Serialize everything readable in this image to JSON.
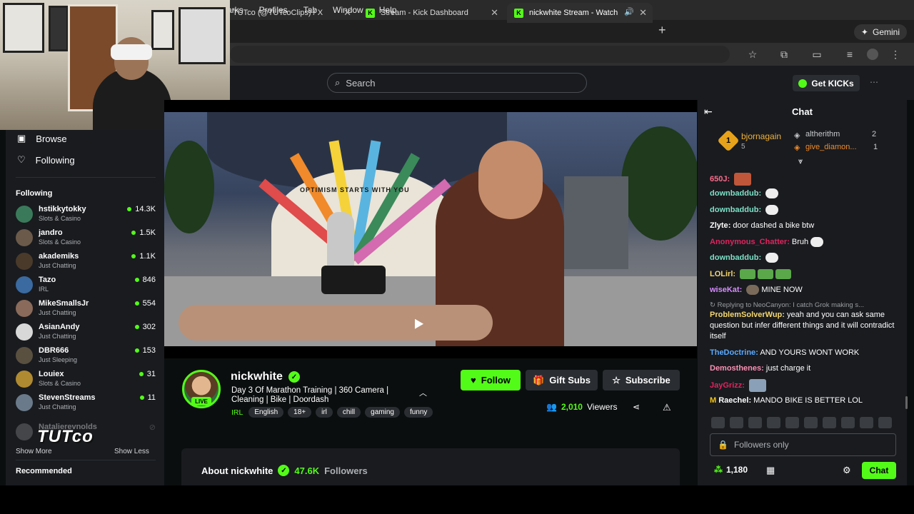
{
  "menubar": {
    "items": [
      "arks",
      "Profiles",
      "Tab",
      "Window",
      "Help"
    ]
  },
  "tabs": [
    {
      "label": "TUTco (@TUTcoClips) / X"
    },
    {
      "label": "Stream - Kick Dashboard"
    },
    {
      "label": "nickwhite Stream - Watch"
    }
  ],
  "gemini_label": "Gemini",
  "search": {
    "placeholder": "Search"
  },
  "get_kicks_label": "Get KICKs",
  "sidebar": {
    "nav": [
      {
        "label": "Browse"
      },
      {
        "label": "Following"
      }
    ],
    "following_heading": "Following",
    "following": [
      {
        "name": "hstikkytokky",
        "category": "Slots & Casino",
        "viewers": "14.3K"
      },
      {
        "name": "jandro",
        "category": "Slots & Casino",
        "viewers": "1.5K"
      },
      {
        "name": "akademiks",
        "category": "Just Chatting",
        "viewers": "1.1K"
      },
      {
        "name": "Tazo",
        "category": "IRL",
        "viewers": "846"
      },
      {
        "name": "MikeSmallsJr",
        "category": "Just Chatting",
        "viewers": "554"
      },
      {
        "name": "AsianAndy",
        "category": "Just Chatting",
        "viewers": "302"
      },
      {
        "name": "DBR666",
        "category": "Just Sleeping",
        "viewers": "153"
      },
      {
        "name": "Louiex",
        "category": "Slots & Casino",
        "viewers": "31"
      },
      {
        "name": "StevenStreams",
        "category": "Just Chatting",
        "viewers": "11"
      },
      {
        "name": "Natalierevnolds",
        "category": "",
        "viewers": ""
      }
    ],
    "show_more": "Show More",
    "show_less": "Show Less",
    "recommended_heading": "Recommended"
  },
  "watermark": "TUTco",
  "video": {
    "mural_text": "OPTIMISM STARTS WITH YOU"
  },
  "stream": {
    "name": "nickwhite",
    "live_label": "LIVE",
    "title": "Day 3 Of Marathon Training | 360 Camera | Cleaning | Bike | Doordash",
    "category": "IRL",
    "tags": [
      "English",
      "18+",
      "irl",
      "chill",
      "gaming",
      "funny"
    ],
    "follow_label": "Follow",
    "gift_label": "Gift Subs",
    "subscribe_label": "Subscribe",
    "viewers_count": "2,010",
    "viewers_label": "Viewers"
  },
  "about": {
    "title": "About nickwhite",
    "followers_count": "47.6K",
    "followers_label": "Followers"
  },
  "chat": {
    "title": "Chat",
    "leaderboard": {
      "first": {
        "name": "bjornagain",
        "count": "5"
      },
      "second": {
        "name": "altherithm",
        "count": "2"
      },
      "third": {
        "name": "give_diamon...",
        "count": "1"
      }
    },
    "messages": [
      {
        "user": "650J",
        "text": "",
        "color": "#ff6b8a"
      },
      {
        "user": "downbaddub",
        "text": "",
        "color": "#7fe0c8"
      },
      {
        "user": "downbaddub",
        "text": "",
        "color": "#7fe0c8"
      },
      {
        "user": "Zlyte",
        "text": "door dashed a bike btw",
        "color": "#ffffff"
      },
      {
        "user": "Anonymous_Chatter",
        "text": "Bruh",
        "color": "#e0245e"
      },
      {
        "user": "downbaddub",
        "text": "",
        "color": "#7fe0c8"
      },
      {
        "user": "LOLirl",
        "text": "",
        "color": "#f5d76e"
      },
      {
        "user": "wiseKat",
        "text": "MINE NOW",
        "color": "#d88cff"
      },
      {
        "reply": "Replying to NeoCanyon: I catch Grok making s..."
      },
      {
        "user": "ProblemSolverWup",
        "text": "yeah and you can ask same question but infer different things and it will contradict itself",
        "color": "#f5d76e"
      },
      {
        "user": "TheDoctrine",
        "text": "AND YOURS WONT WORK",
        "color": "#5aa9ff"
      },
      {
        "user": "Demosthenes",
        "text": "just charge it",
        "color": "#ff8fb3"
      },
      {
        "user": "JayGrizz",
        "text": "",
        "color": "#e0245e"
      },
      {
        "user": "Raechel",
        "text": "MANDO BIKE IS BETTER LOL",
        "color": "#ffffff"
      }
    ],
    "input_placeholder": "Followers only",
    "kicks_balance": "1,180",
    "send_label": "Chat"
  },
  "colors": {
    "kick_green": "#53fc18",
    "panel": "#191b1f",
    "page": "#0b0e0f"
  }
}
